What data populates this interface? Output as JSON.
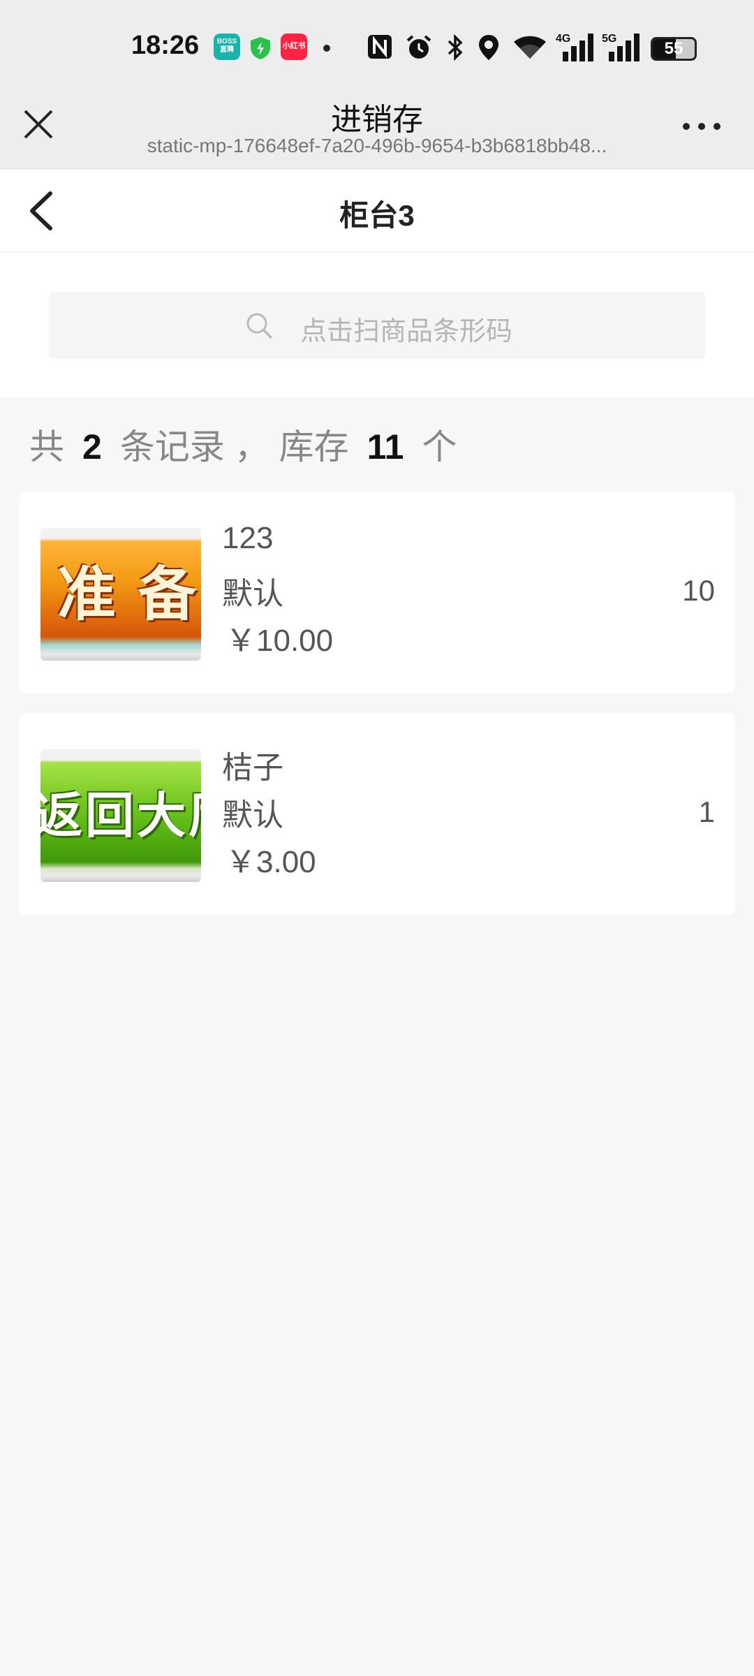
{
  "status_bar": {
    "time": "18:26",
    "app_icons": [
      {
        "name": "boss-zhipin-icon",
        "text": "BOSS\n直聘",
        "color": "#19b4a9"
      },
      {
        "name": "security-shield-icon",
        "color": "#27c24c"
      },
      {
        "name": "xiaohongshu-icon",
        "text": "小红书",
        "color": "#ff2442"
      }
    ],
    "battery_level": "55",
    "network": [
      "4G",
      "5G"
    ]
  },
  "mini_program": {
    "title": "进销存",
    "subtitle": "static-mp-176648ef-7a20-496b-9654-b3b6818bb48..."
  },
  "nav": {
    "title": "柜台3"
  },
  "search": {
    "placeholder": "点击扫商品条形码"
  },
  "summary": {
    "prefix": "共",
    "record_count": "2",
    "middle": "条记录 ， 库存",
    "stock_count": "11",
    "suffix": "个"
  },
  "products": [
    {
      "image_label": "准 备",
      "name": "123",
      "spec": "默认",
      "price": "￥10.00",
      "quantity": "10"
    },
    {
      "image_label": "返回大厅",
      "name": "桔子",
      "spec": "默认",
      "price": "￥3.00",
      "quantity": "1"
    }
  ],
  "colors": {
    "page_bg": "#f7f7f9",
    "header_bg": "#ededed",
    "card_bg": "#ffffff",
    "thumb1_main": "#f39a13",
    "thumb2_main": "#6cc41c"
  }
}
